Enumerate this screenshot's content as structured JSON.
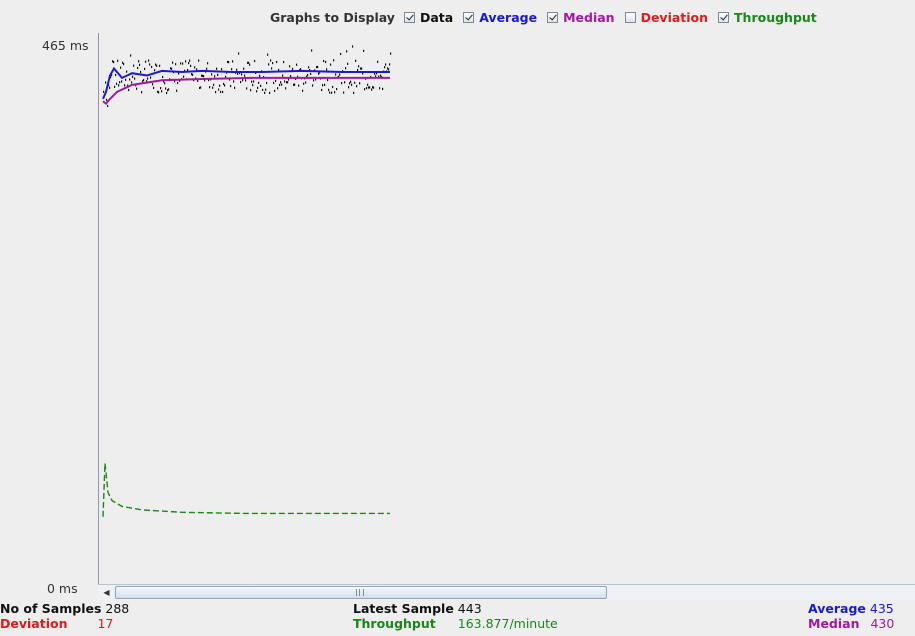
{
  "legend": {
    "title": "Graphs to Display",
    "items": [
      {
        "id": "data",
        "label": "Data",
        "checked": true,
        "color": "#111111"
      },
      {
        "id": "average",
        "label": "Average",
        "checked": true,
        "color": "#1a1ad6"
      },
      {
        "id": "median",
        "label": "Median",
        "checked": true,
        "color": "#a01aa0"
      },
      {
        "id": "deviation",
        "label": "Deviation",
        "checked": false,
        "color": "#e01a1a"
      },
      {
        "id": "throughput",
        "label": "Throughput",
        "checked": true,
        "color": "#188818"
      }
    ]
  },
  "axis": {
    "y_max_label": "465  ms",
    "y_min_label": "0  ms"
  },
  "stats": {
    "samples_label": "No of Samples",
    "samples_value": "288",
    "deviation_label": "Deviation",
    "deviation_value": "17",
    "latest_label": "Latest Sample",
    "latest_value": "443",
    "throughput_label": "Throughput",
    "throughput_value": "163.877/minute",
    "average_label": "Average",
    "average_value": "435",
    "median_label": "Median",
    "median_value": "430"
  },
  "chart_data": {
    "type": "line",
    "y_unit": "ms",
    "ylim": [
      0,
      465
    ],
    "sample_count": 288,
    "series": [
      {
        "name": "Data",
        "color": "#111111"
      },
      {
        "name": "Average",
        "color": "#1a1ad6",
        "values": [
          [
            1,
            412
          ],
          [
            4,
            418
          ],
          [
            8,
            432
          ],
          [
            12,
            438
          ],
          [
            20,
            430
          ],
          [
            30,
            434
          ],
          [
            45,
            432
          ],
          [
            60,
            436
          ],
          [
            80,
            435
          ],
          [
            100,
            436
          ],
          [
            130,
            435
          ],
          [
            160,
            435
          ],
          [
            200,
            436
          ],
          [
            240,
            435
          ],
          [
            288,
            435
          ]
        ]
      },
      {
        "name": "Median",
        "color": "#a01aa0",
        "values": [
          [
            1,
            410
          ],
          [
            4,
            408
          ],
          [
            8,
            412
          ],
          [
            15,
            418
          ],
          [
            30,
            424
          ],
          [
            60,
            428
          ],
          [
            100,
            429
          ],
          [
            150,
            430
          ],
          [
            200,
            430
          ],
          [
            250,
            430
          ],
          [
            288,
            430
          ]
        ]
      },
      {
        "name": "Throughput",
        "color": "#188818",
        "values": [
          [
            1,
            54
          ],
          [
            3,
            100
          ],
          [
            6,
            75
          ],
          [
            10,
            68
          ],
          [
            20,
            63
          ],
          [
            40,
            60
          ],
          [
            80,
            58
          ],
          [
            140,
            57
          ],
          [
            200,
            57
          ],
          [
            288,
            57
          ]
        ]
      }
    ]
  }
}
